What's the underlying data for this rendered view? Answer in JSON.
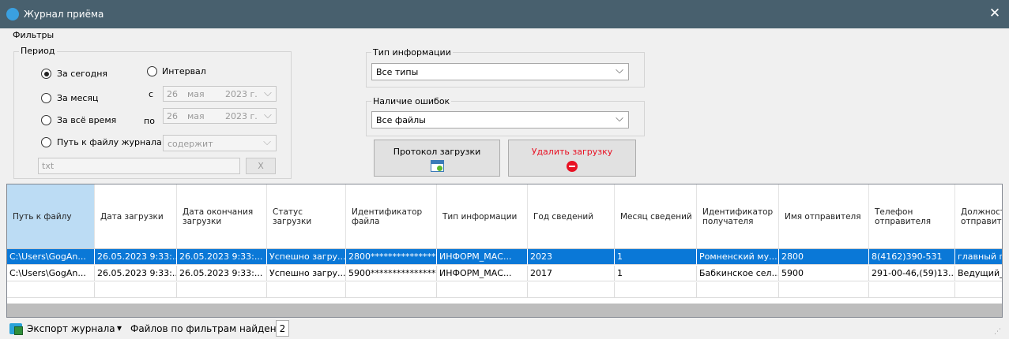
{
  "window": {
    "title": "Журнал приёма",
    "close_glyph": "✕",
    "icon": "app-logo-icon"
  },
  "filters": {
    "legend": "Фильтры",
    "period": {
      "legend": "Период",
      "today": "За сегодня",
      "interval": "Интервал",
      "month": "За месяц",
      "all_time": "За всё время",
      "file_path": "Путь к файлу журнала",
      "from_label": "с",
      "to_label": "по",
      "from_date": {
        "day": "26",
        "month": "мая",
        "year": "2023 г."
      },
      "to_date": {
        "day": "26",
        "month": "мая",
        "year": "2023 г."
      },
      "path_mode": "содержит",
      "path_value": "txt",
      "clear_label": "X",
      "selected": "today"
    },
    "info_type": {
      "legend": "Тип информации",
      "value": "Все типы"
    },
    "errors": {
      "legend": "Наличие ошибок",
      "value": "Все файлы"
    },
    "buttons": {
      "protocol": "Протокол загрузки",
      "delete": "Удалить загрузку"
    },
    "colors": {
      "delete_text": "#e81123",
      "delete_icon": "#e81123",
      "selection": "#0a78d7"
    }
  },
  "table": {
    "columns": [
      "Путь к файлу",
      "Дата загрузки",
      "Дата окончания загрузки",
      "Статус загрузки",
      "Идентификатор файла",
      "Тип информации",
      "Год сведений",
      "Месяц сведений",
      "Идентификатор получателя",
      "Имя отправителя",
      "Телефон отправителя",
      "Должность отправит"
    ],
    "rows": [
      [
        "C:\\Users\\GogAn...",
        "26.05.2023 9:33:...",
        "26.05.2023 9:33:...",
        "Успешно загру...",
        "2800***************...",
        "ИНФОРМ_МАС...",
        "2023",
        "1",
        "Ромненский му...",
        "2800",
        "8(4162)390-531",
        "главный г"
      ],
      [
        "C:\\Users\\GogAn...",
        "26.05.2023 9:33:...",
        "26.05.2023 9:33:...",
        "Успешно загру...",
        "5900***************...",
        "ИНФОРМ_МАС...",
        "2017",
        "1",
        "Бабкинское сел...",
        "5900",
        "291-00-46,(59)13...",
        "Ведущий_"
      ]
    ],
    "selected_row": 0
  },
  "statusbar": {
    "export_label": "Экспорт журнала",
    "dropdown_glyph": "▾",
    "found_label": "Файлов по фильтрам найдено",
    "found_count": "2"
  }
}
